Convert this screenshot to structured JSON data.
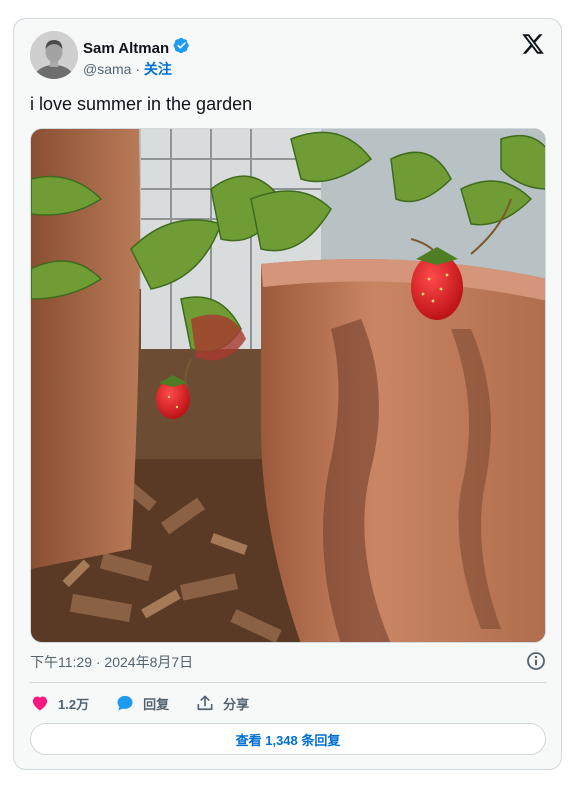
{
  "author": {
    "name": "Sam Altman",
    "handle": "@sama",
    "separator": " · ",
    "follow_label": "关注"
  },
  "tweet": {
    "text": "i love summer in the garden",
    "timestamp": "下午11:29 · 2024年8月7日"
  },
  "actions": {
    "likes": "1.2万",
    "reply_label": "回复",
    "share_label": "分享"
  },
  "view_replies_label": "查看 1,348 条回复",
  "colors": {
    "like": "#f91880",
    "reply": "#1d9bf0",
    "verified": "#1d9bf0",
    "link": "#006fd6"
  },
  "icons": {
    "verified": "verified-badge-icon",
    "brand": "x-logo-icon",
    "info": "info-icon",
    "like": "heart-icon",
    "reply": "speech-bubble-icon",
    "share": "share-icon"
  }
}
